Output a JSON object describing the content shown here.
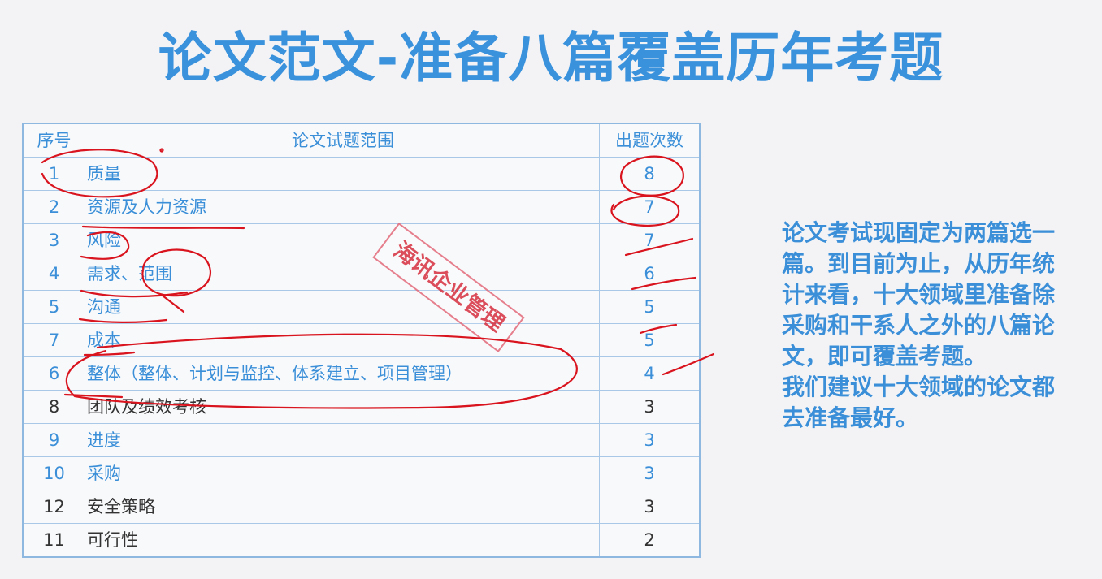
{
  "title": "论文范文-准备八篇覆盖历年考题",
  "table": {
    "headers": [
      "序号",
      "论文试题范围",
      "出题次数"
    ],
    "rows": [
      {
        "no": "1",
        "topic": "质量",
        "count": "8",
        "color": "blue"
      },
      {
        "no": "2",
        "topic": "资源及人力资源",
        "count": "7",
        "color": "blue"
      },
      {
        "no": "3",
        "topic": "风险",
        "count": "7",
        "color": "blue"
      },
      {
        "no": "4",
        "topic": "需求、范围",
        "count": "6",
        "color": "blue"
      },
      {
        "no": "5",
        "topic": "沟通",
        "count": "5",
        "color": "blue"
      },
      {
        "no": "7",
        "topic": "成本",
        "count": "5",
        "color": "blue"
      },
      {
        "no": "6",
        "topic": "整体（整体、计划与监控、体系建立、项目管理）",
        "count": "4",
        "color": "blue"
      },
      {
        "no": "8",
        "topic": "团队及绩效考核",
        "count": "3",
        "color": "dark"
      },
      {
        "no": "9",
        "topic": "进度",
        "count": "3",
        "color": "blue"
      },
      {
        "no": "10",
        "topic": "采购",
        "count": "3",
        "color": "blue"
      },
      {
        "no": "12",
        "topic": "安全策略",
        "count": "3",
        "color": "dark"
      },
      {
        "no": "11",
        "topic": "可行性",
        "count": "2",
        "color": "dark"
      }
    ]
  },
  "stamp": "海讯企业管理",
  "note": {
    "paragraph1": "论文考试现固定为两篇选一篇。到目前为止，从历年统计来看，十大领域里准备除采购和干系人之外的八篇论文，即可覆盖考题。",
    "paragraph2": "我们建议十大领域的论文都去准备最好。"
  },
  "colors": {
    "title": "#3a92dc",
    "table_text": "#3a8fd8",
    "table_border": "#a9c8e8",
    "stamp": "#d6303f",
    "ink": "#d9141e"
  }
}
